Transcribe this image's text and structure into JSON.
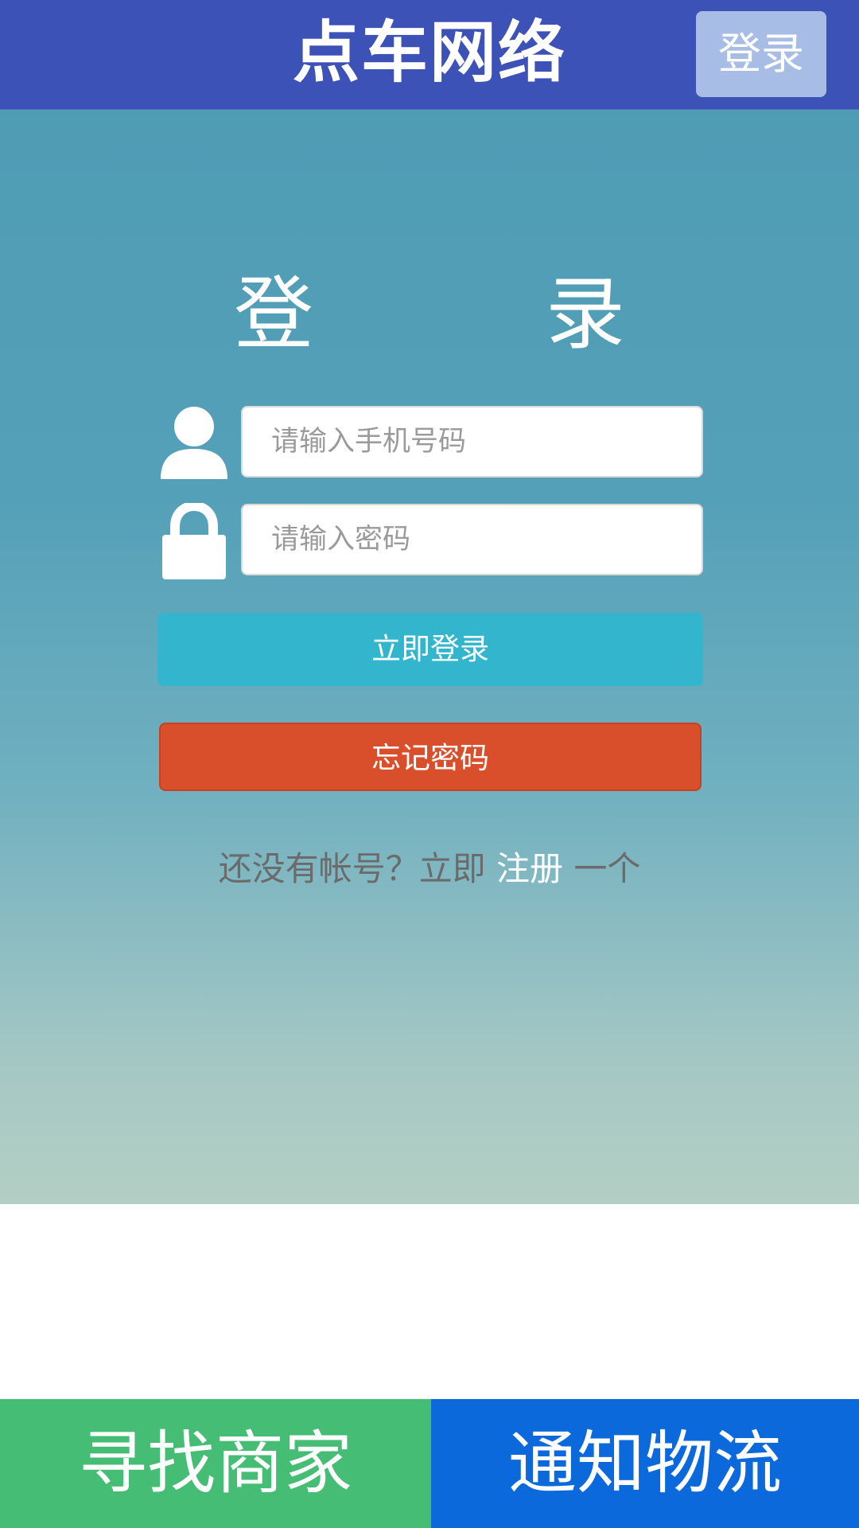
{
  "header": {
    "title": "点车网络",
    "login_label": "登录"
  },
  "login": {
    "title": "登 录",
    "phone_placeholder": "请输入手机号码",
    "password_placeholder": "请输入密码",
    "submit_label": "立即登录",
    "forgot_label": "忘记密码",
    "register_prefix": "还没有帐号？立即",
    "register_link": "注册",
    "register_suffix": "一个",
    "icons": {
      "user": "user-icon",
      "lock": "lock-icon"
    }
  },
  "bottom_nav": {
    "left_label": "寻找商家",
    "right_label": "通知物流"
  },
  "colors": {
    "header_bg": "#3d52b6",
    "header_button_bg": "#a7bde6",
    "login_button_bg": "#33b6cd",
    "forgot_button_bg": "#d94f2b",
    "bottom_left_bg": "#46bd74",
    "bottom_right_bg": "#0b69db"
  }
}
